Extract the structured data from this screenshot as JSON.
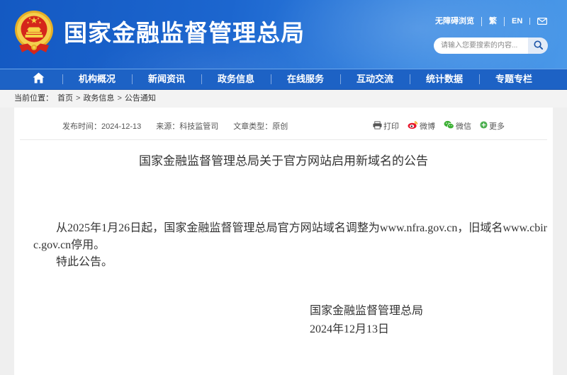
{
  "header": {
    "site_title": "国家金融监督管理总局",
    "top_links": [
      "无障碍浏览",
      "繁",
      "EN"
    ],
    "search_placeholder": "请输入您要搜索的内容..."
  },
  "nav": {
    "items": [
      "机构概况",
      "新闻资讯",
      "政务信息",
      "在线服务",
      "互动交流",
      "统计数据",
      "专题专栏"
    ]
  },
  "breadcrumb": {
    "label": "当前位置：",
    "separator": ">",
    "items": [
      "首页",
      "政务信息",
      "公告通知"
    ]
  },
  "article": {
    "meta": {
      "date_label": "发布时间：",
      "date": "2024-12-13",
      "source_label": "来源：",
      "source": "科技监管司",
      "type_label": "文章类型：",
      "type": "原创"
    },
    "share": {
      "print": "打印",
      "weibo": "微博",
      "wechat": "微信",
      "more": "更多"
    },
    "title": "国家金融监督管理总局关于官方网站启用新域名的公告",
    "paragraphs": [
      "从2025年1月26日起，国家金融监督管理总局官方网站域名调整为www.nfra.gov.cn，旧域名www.cbirc.gov.cn停用。",
      "特此公告。"
    ],
    "signature": {
      "org": "国家金融监督管理总局",
      "date": "2024年12月13日"
    }
  },
  "icons": {
    "emblem": "national-emblem-icon",
    "mail": "mail-icon",
    "search": "search-icon",
    "home": "home-icon",
    "print": "printer-icon",
    "weibo": "weibo-icon",
    "wechat": "wechat-icon",
    "more": "plus-circle-icon"
  },
  "colors": {
    "header_blue": "#1c66cf",
    "nav_blue": "#1d62c5",
    "weibo_red": "#e6162d",
    "wechat_green": "#3cb034",
    "page_gray": "#efefef"
  }
}
